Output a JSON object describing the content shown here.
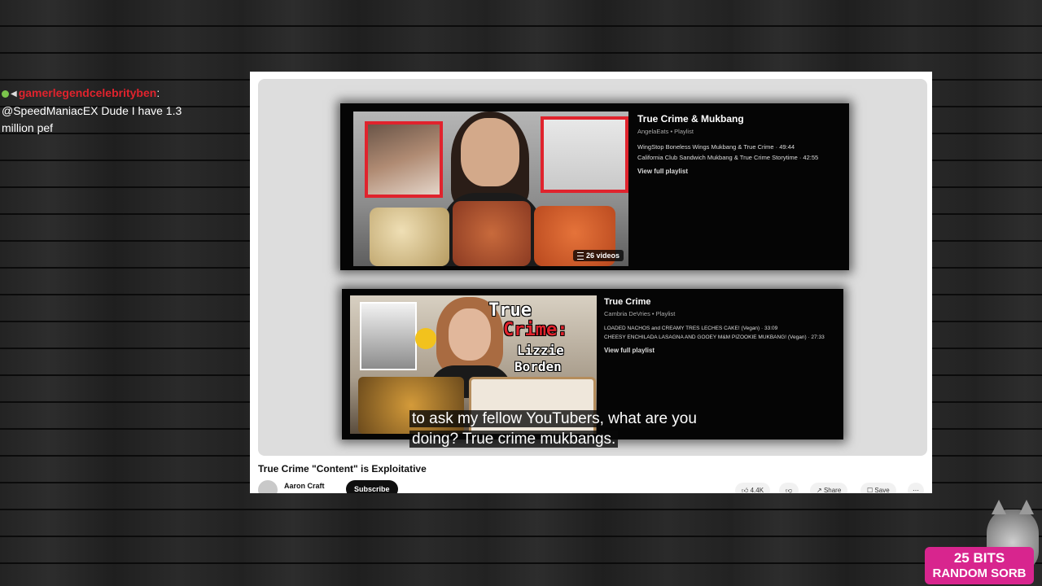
{
  "chat": {
    "username": "gamerlegendcelebrityben",
    "message": "@SpeedManiacEX Dude I have 1.3 million pef"
  },
  "playlists": [
    {
      "title": "True Crime & Mukbang",
      "subtitle": "AngelaEats • Playlist",
      "items": [
        "WingStop Boneless Wings Mukbang & True Crime · 49:44",
        "California Club Sandwich Mukbang & True Crime Storytime · 42:55"
      ],
      "view_label": "View full playlist",
      "video_count": "26 videos"
    },
    {
      "title": "True Crime",
      "subtitle": "Cambria DeVries • Playlist",
      "items": [
        "LOADED NACHOS and CREAMY TRES LECHES CAKE! (Vegan) · 33:09",
        "CHEESY ENCHILADA LASAGNA AND GOOEY M&M PIZOOKIE MUKBANG! (Vegan) · 27:33"
      ],
      "view_label": "View full playlist",
      "thumb_text": [
        "True",
        "Crime:",
        "Lizzie",
        "Borden"
      ]
    }
  ],
  "caption": {
    "line1": "to ask my fellow YouTubers, what are you",
    "line2": "doing? True crime mukbangs."
  },
  "video": {
    "title": "True Crime \"Content\" is Exploitative",
    "channel": "Aaron Craft",
    "subscribe_label": "Subscribe",
    "likes": "4.4K",
    "share_label": "Share",
    "save_label": "Save"
  },
  "alert": {
    "line1": "25 BITS",
    "line2": "RANDOM SORB"
  },
  "colors": {
    "username": "#e0232d",
    "thumb_border": "#e0232d",
    "bits_bg": "#d8258e"
  }
}
